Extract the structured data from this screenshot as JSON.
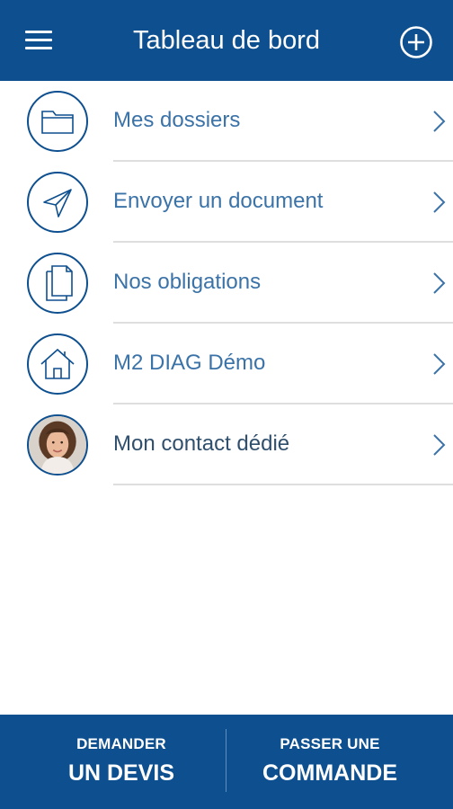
{
  "header": {
    "title": "Tableau de bord",
    "menu_icon": "hamburger-menu-icon",
    "add_icon": "add-circle-icon"
  },
  "menu": {
    "items": [
      {
        "label": "Mes dossiers",
        "icon": "folder-icon"
      },
      {
        "label": "Envoyer un document",
        "icon": "paper-plane-icon"
      },
      {
        "label": "Nos obligations",
        "icon": "documents-icon"
      },
      {
        "label": "M2 DIAG Démo",
        "icon": "home-icon"
      },
      {
        "label": "Mon contact dédié",
        "icon": "contact-photo"
      }
    ]
  },
  "footer": {
    "quote_top": "DEMANDER",
    "quote_bottom": "UN DEVIS",
    "order_top": "PASSER UNE",
    "order_bottom": "COMMANDE"
  },
  "colors": {
    "brand_blue": "#0d4f8f",
    "label_blue": "#3b73a8",
    "divider": "#dedede"
  }
}
